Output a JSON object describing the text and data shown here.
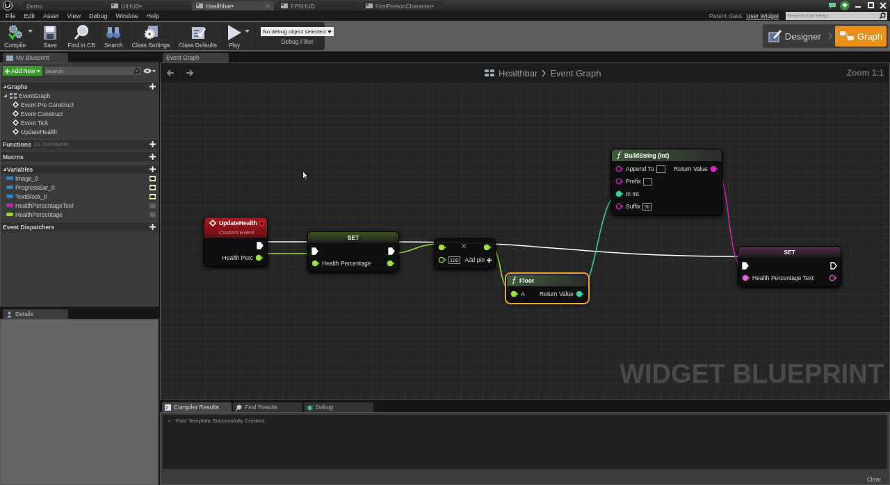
{
  "title_tabs": [
    {
      "label": "Demo",
      "kind": "project",
      "selected": false
    },
    {
      "label": "UIHUD•",
      "kind": "asset",
      "selected": false
    },
    {
      "label": "Healthbar•",
      "kind": "asset",
      "selected": true
    },
    {
      "label": "FPSHUD",
      "kind": "asset",
      "selected": false
    },
    {
      "label": "FirstPersonCharacter•",
      "kind": "asset",
      "selected": false
    }
  ],
  "menu": [
    "File",
    "Edit",
    "Asset",
    "View",
    "Debug",
    "Window",
    "Help"
  ],
  "parent_class": {
    "label": "Parent class:",
    "value": "User Widget"
  },
  "help_search": {
    "placeholder": "Search For Help"
  },
  "toolbar": [
    {
      "label": "Compile",
      "kind": "compile",
      "menu": true
    },
    {
      "label": "Save",
      "kind": "save",
      "menu": false
    },
    {
      "label": "Find in CB",
      "kind": "find",
      "menu": false
    },
    {
      "label": "Search",
      "kind": "search",
      "menu": false
    },
    {
      "label": "Class Settings",
      "kind": "settings",
      "menu": false
    },
    {
      "label": "Class Defaults",
      "kind": "defaults",
      "menu": false
    },
    {
      "label": "Play",
      "kind": "play",
      "menu": true
    }
  ],
  "debug_filter": {
    "value": "No debug object selected",
    "label": "Debug Filter"
  },
  "modes": [
    {
      "label": "Designer",
      "selected": false
    },
    {
      "label": "Graph",
      "selected": true
    }
  ],
  "my_blueprint": {
    "tab": "My Blueprint",
    "add_new": "Add New",
    "search_placeholder": "Search",
    "sections": [
      {
        "title": "Graphs",
        "expanded": true,
        "items": [
          {
            "label": "EventGraph",
            "kind": "graph",
            "expanded": true,
            "children": [
              {
                "label": "Event Pre Construct",
                "kind": "event"
              },
              {
                "label": "Event Construct",
                "kind": "event"
              },
              {
                "label": "Event Tick",
                "kind": "event"
              },
              {
                "label": "UpdateHealth",
                "kind": "event"
              }
            ]
          }
        ]
      },
      {
        "title": "Functions",
        "note": "(31 Overridable)",
        "expanded": false
      },
      {
        "title": "Macros",
        "expanded": false
      },
      {
        "title": "Variables",
        "expanded": true,
        "items": [
          {
            "label": "Image_0",
            "color": "#2f86cc",
            "exposed": true
          },
          {
            "label": "ProgressBar_0",
            "color": "#2f86cc",
            "exposed": true
          },
          {
            "label": "TextBlock_0",
            "color": "#2f86cc",
            "exposed": true
          },
          {
            "label": "HealthPercentageText",
            "color": "#d41cc4",
            "exposed": false
          },
          {
            "label": "HealthPercentage",
            "color": "#8fd838",
            "exposed": false
          }
        ]
      },
      {
        "title": "Event Dispatchers",
        "expanded": false
      }
    ]
  },
  "details": {
    "tab": "Details"
  },
  "graph": {
    "tab": "Event Graph",
    "breadcrumb": [
      "Healthbar",
      "Event Graph"
    ],
    "zoom": "Zoom 1:1",
    "watermark": "WIDGET BLUEPRINT",
    "nodes": [
      {
        "kind": "event",
        "title": "UpdateHealth",
        "subtitle": "Custom Event",
        "selected": false,
        "delegate_pin": {
          "linked": false
        },
        "outputs": [
          {
            "kind": "exec",
            "linked": true
          },
          {
            "label": "Health Perc",
            "kind": "float",
            "linked": true
          }
        ]
      },
      {
        "kind": "set",
        "title": "SET",
        "selected": false,
        "inputs": [
          {
            "kind": "exec",
            "linked": true
          },
          {
            "label": "Health Percentage",
            "kind": "float",
            "linked": true
          }
        ],
        "outputs": [
          {
            "kind": "exec",
            "linked": true
          },
          {
            "kind": "float",
            "linked": true
          }
        ]
      },
      {
        "kind": "math",
        "symbol": "×",
        "add_pin": "Add pin",
        "selected": false,
        "inputs": [
          {
            "kind": "float",
            "linked": true
          },
          {
            "kind": "float",
            "linked": false,
            "field": true,
            "value": "100"
          }
        ],
        "outputs": [
          {
            "kind": "float",
            "linked": true
          }
        ]
      },
      {
        "kind": "function",
        "title": "Floor",
        "selected": true,
        "inputs": [
          {
            "label": "A",
            "kind": "float",
            "linked": true
          }
        ],
        "outputs": [
          {
            "label": "Return Value",
            "kind": "int",
            "linked": true
          }
        ]
      },
      {
        "kind": "function",
        "title": "BuildString (int)",
        "selected": false,
        "inputs": [
          {
            "label": "Append To",
            "kind": "string",
            "linked": false,
            "field": true
          },
          {
            "label": "Prefix",
            "kind": "string",
            "linked": false,
            "field": true
          },
          {
            "label": "In Int",
            "kind": "int",
            "linked": true
          },
          {
            "label": "Suffix",
            "kind": "string",
            "linked": false,
            "field": true,
            "value": "%"
          }
        ],
        "outputs": [
          {
            "label": "Return Value",
            "kind": "string",
            "linked": true
          }
        ]
      },
      {
        "kind": "set",
        "title": "SET",
        "selected": false,
        "inputs": [
          {
            "kind": "exec",
            "linked": true
          },
          {
            "label": "Health Percentage Text",
            "kind": "text",
            "linked": true
          }
        ],
        "outputs": [
          {
            "kind": "exec",
            "linked": false
          },
          {
            "kind": "text",
            "linked": false
          }
        ]
      }
    ]
  },
  "bottom": {
    "tabs": [
      {
        "label": "Compiler Results",
        "kind": "compiler",
        "selected": true
      },
      {
        "label": "Find Results",
        "kind": "find",
        "selected": false
      },
      {
        "label": "Debug",
        "kind": "debug",
        "selected": false
      }
    ],
    "messages": [
      "Fast Template Successfully Created."
    ],
    "clear": "Clear"
  }
}
